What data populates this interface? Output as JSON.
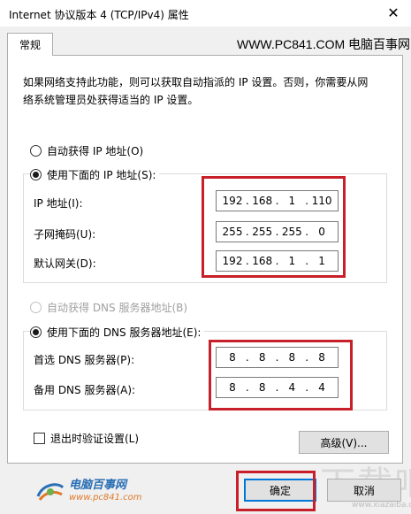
{
  "window": {
    "title": "Internet 协议版本 4 (TCP/IPv4) 属性",
    "close_glyph": "✕"
  },
  "tabs": [
    {
      "label": "常规",
      "active": true
    }
  ],
  "watermark_top": "WWW.PC841.COM 电脑百事网",
  "description": "如果网络支持此功能，则可以获取自动指派的 IP 设置。否则，你需要从网络系统管理员处获得适当的 IP 设置。",
  "ip_section": {
    "auto_label": "自动获得 IP 地址(O)",
    "manual_label": "使用下面的 IP 地址(S):",
    "auto_selected": false,
    "manual_selected": true,
    "fields": [
      {
        "label": "IP 地址(I):",
        "octets": [
          "192",
          "168",
          "1",
          "110"
        ]
      },
      {
        "label": "子网掩码(U):",
        "octets": [
          "255",
          "255",
          "255",
          "0"
        ]
      },
      {
        "label": "默认网关(D):",
        "octets": [
          "192",
          "168",
          "1",
          "1"
        ]
      }
    ]
  },
  "dns_section": {
    "auto_label": "自动获得 DNS 服务器地址(B)",
    "manual_label": "使用下面的 DNS 服务器地址(E):",
    "auto_enabled": false,
    "manual_selected": true,
    "fields": [
      {
        "label": "首选 DNS 服务器(P):",
        "octets": [
          "8",
          "8",
          "8",
          "8"
        ]
      },
      {
        "label": "备用 DNS 服务器(A):",
        "octets": [
          "8",
          "8",
          "4",
          "4"
        ]
      }
    ]
  },
  "validate_on_exit": {
    "label": "退出时验证设置(L)",
    "checked": false
  },
  "buttons": {
    "advanced": "高级(V)...",
    "ok": "确定",
    "cancel": "取消"
  },
  "logo": {
    "name": "电脑百事网",
    "url": "www.pc841.com"
  },
  "corner_watermark": {
    "text": "下载吧",
    "url": "www.xiazaiba.com"
  },
  "colors": {
    "highlight_frame": "#c8202a",
    "default_button_border": "#0078d7",
    "dialog_background": "#f0f0f0"
  }
}
